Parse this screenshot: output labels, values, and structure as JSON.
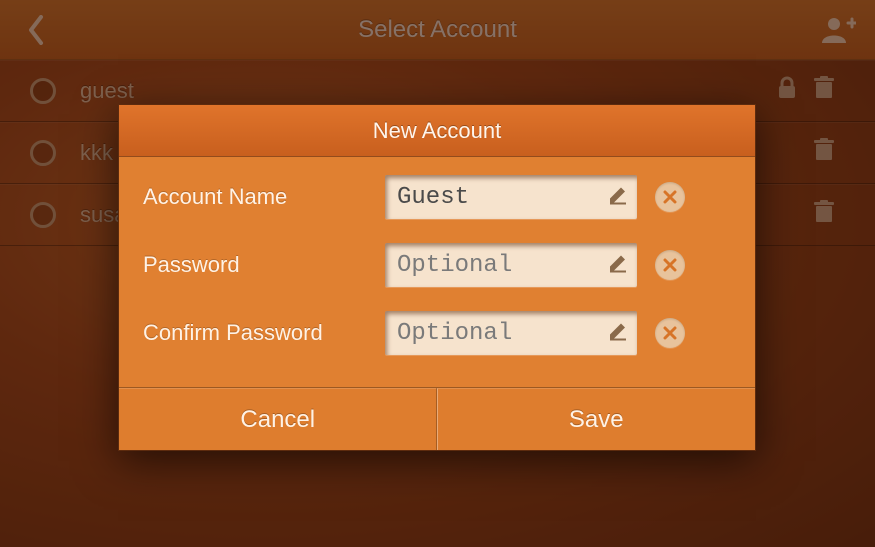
{
  "header": {
    "title": "Select Account"
  },
  "accounts": [
    {
      "name": "guest",
      "locked": true
    },
    {
      "name": "kkk",
      "locked": false
    },
    {
      "name": "susan",
      "locked": false
    }
  ],
  "dialog": {
    "title": "New Account",
    "fields": {
      "account_name": {
        "label": "Account Name",
        "value": "Guest",
        "placeholder": ""
      },
      "password": {
        "label": "Password",
        "value": "",
        "placeholder": "Optional"
      },
      "confirm_password": {
        "label": "Confirm Password",
        "value": "",
        "placeholder": "Optional"
      }
    },
    "cancel_label": "Cancel",
    "save_label": "Save"
  },
  "colors": {
    "accent": "#e08031",
    "field_bg": "#f6e3cd"
  }
}
